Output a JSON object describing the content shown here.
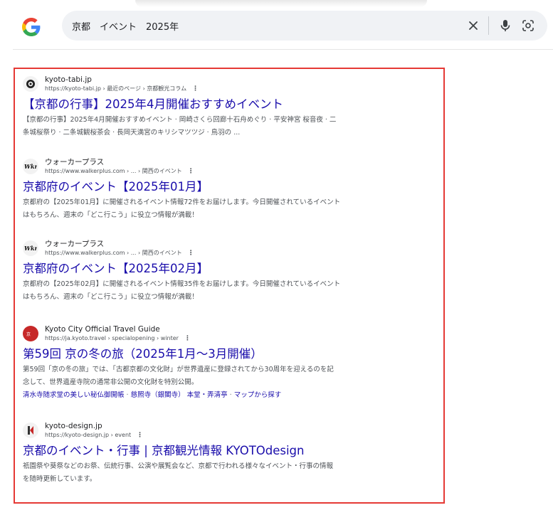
{
  "search": {
    "query": "京都　イベント　2025年"
  },
  "colors": {
    "link": "#1a0dab",
    "highlight_border": "#e53935"
  },
  "icons": {
    "logo": "google-logo",
    "clear": "close-icon",
    "voice": "microphone-icon",
    "lens": "lens-icon",
    "more": "more-vertical-icon"
  },
  "results": [
    {
      "site_name": "kyoto-tabi.jp",
      "url": "https://kyoto-tabi.jp › 最近のページ › 京都観光コラム",
      "title": "【京都の行事】2025年4月開催おすすめイベント",
      "snippet_line1": "【京都の行事】2025年4月開催おすすめイベント · 岡崎さくら回廊十石舟めぐり · 平安神宮 桜音夜 · 二",
      "snippet_line2": "条城桜祭り · 二条城観桜茶会 · 長岡天満宮のキリシマツツジ · 鳥羽の ..."
    },
    {
      "site_name": "ウォーカープラス",
      "url": "https://www.walkerplus.com › ... › 関西のイベント",
      "title": "京都府のイベント【2025年01月】",
      "snippet_line1": "京都府の【2025年01月】に開催されるイベント情報72件をお届けします。今日開催されているイベント",
      "snippet_line2": "はもちろん、週末の「どこ行こう」に役立つ情報が満載！"
    },
    {
      "site_name": "ウォーカープラス",
      "url": "https://www.walkerplus.com › ... › 関西のイベント",
      "title": "京都府のイベント【2025年02月】",
      "snippet_line1": "京都府の【2025年02月】に開催されるイベント情報35件をお届けします。今日開催されているイベント",
      "snippet_line2": "はもちろん、週末の「どこ行こう」に役立つ情報が満載！"
    },
    {
      "site_name": "Kyoto City Official Travel Guide",
      "url": "https://ja.kyoto.travel › specialopening › winter",
      "title": "第59回 京の冬の旅（2025年1月～3月開催）",
      "snippet_line1": "第59回「京の冬の旅」では、「古都京都の文化財」が世界遺産に登録されてから30周年を迎えるのを記",
      "snippet_line2": "念して、世界遺産寺院の通常非公開の文化財を特別公開。",
      "sitelinks": [
        "清水寺随求堂の美しい秘仏御開帳",
        "慈照寺（銀閣寺） 本堂・弄清亭",
        "マップから探す"
      ]
    },
    {
      "site_name": "kyoto-design.jp",
      "url": "https://kyoto-design.jp › event",
      "title": "京都のイベント・行事 | 京都観光情報 KYOTOdesign",
      "snippet_line1": "祇園祭や葵祭などのお祭、伝統行事、公演や展覧会など、京都で行われる様々なイベント・行事の情報",
      "snippet_line2": "を随時更新しています。"
    }
  ]
}
